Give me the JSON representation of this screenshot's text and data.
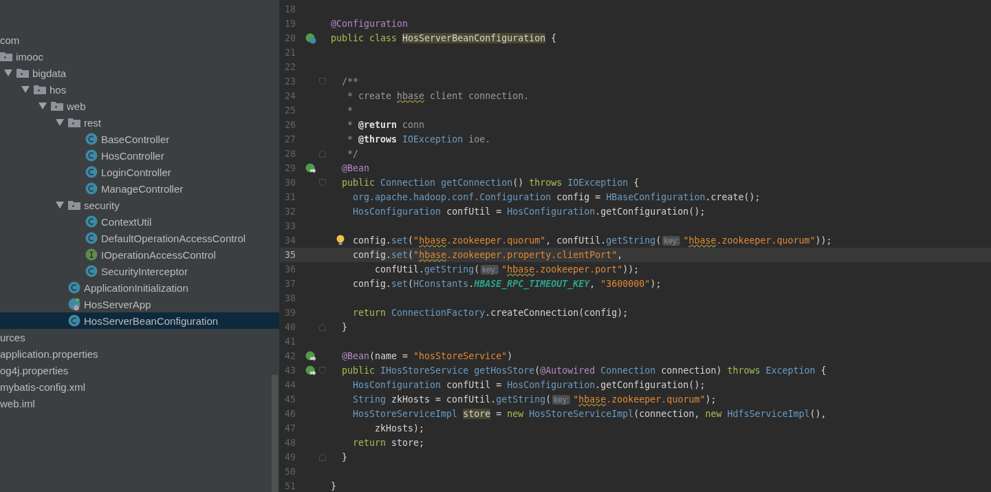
{
  "project_tree": [
    {
      "label": "com",
      "selected": false,
      "children": [
        {
          "label": "imooc",
          "kind": "package",
          "selected": false,
          "children": [
            {
              "label": "bigdata",
              "kind": "package",
              "expanded": true,
              "selected": false,
              "children": [
                {
                  "label": "hos",
                  "kind": "package",
                  "expanded": true,
                  "selected": false,
                  "children": [
                    {
                      "label": "web",
                      "kind": "package",
                      "expanded": true,
                      "selected": false,
                      "children": [
                        {
                          "label": "rest",
                          "kind": "package",
                          "expanded": true,
                          "selected": false,
                          "children": [
                            {
                              "label": "BaseController",
                              "kind": "class",
                              "selected": false
                            },
                            {
                              "label": "HosController",
                              "kind": "class",
                              "selected": false
                            },
                            {
                              "label": "LoginController",
                              "kind": "class",
                              "selected": false
                            },
                            {
                              "label": "ManageController",
                              "kind": "class",
                              "selected": false
                            }
                          ]
                        },
                        {
                          "label": "security",
                          "kind": "package",
                          "expanded": true,
                          "selected": false,
                          "children": [
                            {
                              "label": "ContextUtil",
                              "kind": "class",
                              "selected": false
                            },
                            {
                              "label": "DefaultOperationAccessControl",
                              "kind": "class",
                              "selected": false
                            },
                            {
                              "label": "IOperationAccessControl",
                              "kind": "interface",
                              "selected": false
                            },
                            {
                              "label": "SecurityInterceptor",
                              "kind": "class",
                              "selected": false
                            }
                          ]
                        },
                        {
                          "label": "ApplicationInitialization",
                          "kind": "class",
                          "selected": false
                        },
                        {
                          "label": "HosServerApp",
                          "kind": "app",
                          "selected": false
                        },
                        {
                          "label": "HosServerBeanConfiguration",
                          "kind": "class",
                          "selected": true
                        }
                      ]
                    }
                  ]
                }
              ]
            }
          ]
        }
      ]
    },
    {
      "label": "urces",
      "selected": false
    },
    {
      "label": "application.properties",
      "selected": false
    },
    {
      "label": "og4j.properties",
      "selected": false
    },
    {
      "label": "mybatis-config.xml",
      "selected": false
    },
    {
      "label": "web.iml",
      "selected": false
    }
  ],
  "editor": {
    "lines": [
      {
        "n": "18"
      },
      {
        "n": "19",
        "tokens": [
          {
            "kind": "ann",
            "text": "@Configuration"
          }
        ]
      },
      {
        "n": "20",
        "gutter": {
          "kind": "bean-class"
        },
        "tokens": [
          {
            "kind": "kw",
            "text": "public class "
          },
          {
            "kind": "hl",
            "text": "HosServerBeanConfiguration"
          },
          {
            "kind": "p",
            "text": " {"
          }
        ]
      },
      {
        "n": "21"
      },
      {
        "n": "22"
      },
      {
        "n": "23",
        "fold": {
          "kind": "start"
        },
        "tokens": [
          {
            "kind": "cm",
            "text": "  /**"
          }
        ]
      },
      {
        "n": "24",
        "tokens": [
          {
            "kind": "cm",
            "text": "   * create "
          },
          {
            "kind": "cmtypo",
            "text": "hbase"
          },
          {
            "kind": "cm",
            "text": " client connection."
          }
        ]
      },
      {
        "n": "25",
        "tokens": [
          {
            "kind": "cm",
            "text": "   *"
          }
        ]
      },
      {
        "n": "26",
        "tokens": [
          {
            "kind": "cm",
            "text": "   * "
          },
          {
            "kind": "doc",
            "text": "@return"
          },
          {
            "kind": "cm",
            "text": " conn"
          }
        ]
      },
      {
        "n": "27",
        "tokens": [
          {
            "kind": "cm",
            "text": "   * "
          },
          {
            "kind": "doc",
            "text": "@throws"
          },
          {
            "kind": "type",
            "text": " IOException"
          },
          {
            "kind": "cm",
            "text": " ioe."
          }
        ]
      },
      {
        "n": "28",
        "fold": {
          "kind": "end"
        },
        "tokens": [
          {
            "kind": "cm",
            "text": "   */"
          }
        ]
      },
      {
        "n": "29",
        "gutter": {
          "kind": "bean"
        },
        "tokens": [
          {
            "kind": "ann",
            "text": "  @Bean"
          }
        ]
      },
      {
        "n": "30",
        "fold": {
          "kind": "start"
        },
        "tokens": [
          {
            "kind": "kw",
            "text": "  public "
          },
          {
            "kind": "type",
            "text": "Connection "
          },
          {
            "kind": "fn",
            "text": "getConnection"
          },
          {
            "kind": "p",
            "text": "() "
          },
          {
            "kind": "kw",
            "text": "throws "
          },
          {
            "kind": "type",
            "text": "IOException"
          },
          {
            "kind": "p",
            "text": " {"
          }
        ]
      },
      {
        "n": "31",
        "tokens": [
          {
            "kind": "type",
            "text": "    org.apache.hadoop.conf.Configuration "
          },
          {
            "kind": "p",
            "text": "config = "
          },
          {
            "kind": "type",
            "text": "HBaseConfiguration"
          },
          {
            "kind": "p",
            "text": ".create();"
          }
        ]
      },
      {
        "n": "32",
        "tokens": [
          {
            "kind": "type",
            "text": "    HosConfiguration "
          },
          {
            "kind": "p",
            "text": "confUtil = "
          },
          {
            "kind": "type",
            "text": "HosConfiguration"
          },
          {
            "kind": "p",
            "text": ".getConfiguration();"
          }
        ]
      },
      {
        "n": "33"
      },
      {
        "n": "34",
        "gutter": {
          "kind": "bulb"
        },
        "tokens": [
          {
            "kind": "p",
            "text": "    config."
          },
          {
            "kind": "fn",
            "text": "set"
          },
          {
            "kind": "p",
            "text": "("
          },
          {
            "kind": "str",
            "text": "\""
          },
          {
            "kind": "strtypo",
            "text": "hbase"
          },
          {
            "kind": "str",
            "text": ".zookeeper.quorum\""
          },
          {
            "kind": "p",
            "text": ", confUtil."
          },
          {
            "kind": "fn",
            "text": "getString"
          },
          {
            "kind": "p",
            "text": "("
          },
          {
            "kind": "hint",
            "text": "key:"
          },
          {
            "kind": "str",
            "text": "\""
          },
          {
            "kind": "strtypo",
            "text": "hbase"
          },
          {
            "kind": "str",
            "text": ".zookeeper.quorum\""
          },
          {
            "kind": "p",
            "text": "));"
          }
        ]
      },
      {
        "n": "35",
        "current": true,
        "tokens": [
          {
            "kind": "p",
            "text": "    config."
          },
          {
            "kind": "fn",
            "text": "set"
          },
          {
            "kind": "p",
            "text": "("
          },
          {
            "kind": "str",
            "text": "\""
          },
          {
            "kind": "strtypo",
            "text": "hbase"
          },
          {
            "kind": "str",
            "text": ".zookeeper.property.clientPort\""
          },
          {
            "kind": "p",
            "text": ","
          }
        ]
      },
      {
        "n": "36",
        "tokens": [
          {
            "kind": "p",
            "text": "        confUtil."
          },
          {
            "kind": "fn",
            "text": "getString"
          },
          {
            "kind": "p",
            "text": "("
          },
          {
            "kind": "hint",
            "text": "key:"
          },
          {
            "kind": "str",
            "text": "\""
          },
          {
            "kind": "strtypo",
            "text": "hbase"
          },
          {
            "kind": "str",
            "text": ".zookeeper.port\""
          },
          {
            "kind": "p",
            "text": "));"
          }
        ]
      },
      {
        "n": "37",
        "tokens": [
          {
            "kind": "p",
            "text": "    config."
          },
          {
            "kind": "fn",
            "text": "set"
          },
          {
            "kind": "p",
            "text": "("
          },
          {
            "kind": "type",
            "text": "HConstants"
          },
          {
            "kind": "p",
            "text": "."
          },
          {
            "kind": "const",
            "text": "HBASE_RPC_TIMEOUT_KEY"
          },
          {
            "kind": "p",
            "text": ", "
          },
          {
            "kind": "str",
            "text": "\"3600000\""
          },
          {
            "kind": "p",
            "text": ");"
          }
        ]
      },
      {
        "n": "38"
      },
      {
        "n": "39",
        "tokens": [
          {
            "kind": "kw",
            "text": "    return "
          },
          {
            "kind": "type",
            "text": "ConnectionFactory"
          },
          {
            "kind": "p",
            "text": ".createConnection(config);"
          }
        ]
      },
      {
        "n": "40",
        "fold": {
          "kind": "end"
        },
        "tokens": [
          {
            "kind": "p",
            "text": "  }"
          }
        ]
      },
      {
        "n": "41"
      },
      {
        "n": "42",
        "gutter": {
          "kind": "bean"
        },
        "tokens": [
          {
            "kind": "ann",
            "text": "  @Bean"
          },
          {
            "kind": "p",
            "text": "(name = "
          },
          {
            "kind": "str",
            "text": "\"hosStoreService\""
          },
          {
            "kind": "p",
            "text": ")"
          }
        ]
      },
      {
        "n": "43",
        "gutter": {
          "kind": "bean"
        },
        "fold": {
          "kind": "start"
        },
        "tokens": [
          {
            "kind": "kw",
            "text": "  public "
          },
          {
            "kind": "type",
            "text": "IHosStoreService "
          },
          {
            "kind": "fn",
            "text": "getHosStore"
          },
          {
            "kind": "p",
            "text": "("
          },
          {
            "kind": "ann",
            "text": "@Autowired "
          },
          {
            "kind": "type",
            "text": "Connection "
          },
          {
            "kind": "p",
            "text": "connection) "
          },
          {
            "kind": "kw",
            "text": "throws "
          },
          {
            "kind": "type",
            "text": "Exception"
          },
          {
            "kind": "p",
            "text": " {"
          }
        ]
      },
      {
        "n": "44",
        "tokens": [
          {
            "kind": "type",
            "text": "    HosConfiguration "
          },
          {
            "kind": "p",
            "text": "confUtil = "
          },
          {
            "kind": "type",
            "text": "HosConfiguration"
          },
          {
            "kind": "p",
            "text": ".getConfiguration();"
          }
        ]
      },
      {
        "n": "45",
        "tokens": [
          {
            "kind": "type",
            "text": "    String "
          },
          {
            "kind": "p",
            "text": "zkHosts = confUtil."
          },
          {
            "kind": "fn",
            "text": "getString"
          },
          {
            "kind": "p",
            "text": "("
          },
          {
            "kind": "hint",
            "text": "key:"
          },
          {
            "kind": "str",
            "text": "\""
          },
          {
            "kind": "strtypo",
            "text": "hbase"
          },
          {
            "kind": "str",
            "text": ".zookeeper.quorum\""
          },
          {
            "kind": "p",
            "text": ");"
          }
        ]
      },
      {
        "n": "46",
        "tokens": [
          {
            "kind": "type",
            "text": "    HosStoreServiceImpl "
          },
          {
            "kind": "hl",
            "text": "store"
          },
          {
            "kind": "p",
            "text": " = "
          },
          {
            "kind": "kw",
            "text": "new "
          },
          {
            "kind": "type",
            "text": "HosStoreServiceImpl"
          },
          {
            "kind": "p",
            "text": "(connection, "
          },
          {
            "kind": "kw",
            "text": "new "
          },
          {
            "kind": "type",
            "text": "HdfsServiceImpl"
          },
          {
            "kind": "p",
            "text": "(),"
          }
        ]
      },
      {
        "n": "47",
        "tokens": [
          {
            "kind": "p",
            "text": "        zkHosts);"
          }
        ]
      },
      {
        "n": "48",
        "tokens": [
          {
            "kind": "kw",
            "text": "    return "
          },
          {
            "kind": "p",
            "text": "store;"
          }
        ]
      },
      {
        "n": "49",
        "fold": {
          "kind": "end"
        },
        "tokens": [
          {
            "kind": "p",
            "text": "  }"
          }
        ]
      },
      {
        "n": "50"
      },
      {
        "n": "51",
        "tokens": [
          {
            "kind": "p",
            "text": "}"
          }
        ]
      }
    ]
  }
}
